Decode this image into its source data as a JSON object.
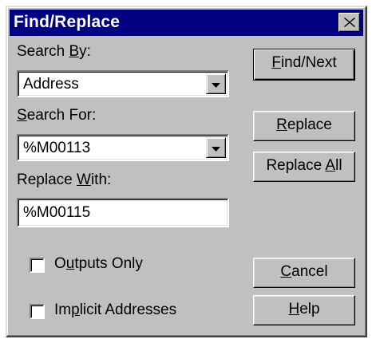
{
  "window": {
    "title": "Find/Replace",
    "close_glyph": "✕"
  },
  "search_by": {
    "label_pre": "Search ",
    "label_mnemonic": "B",
    "label_post": "y:",
    "value": "Address"
  },
  "search_for": {
    "label_pre": "",
    "label_mnemonic": "S",
    "label_post": "earch For:",
    "value": "%M00113"
  },
  "replace_with": {
    "label_pre": "Replace ",
    "label_mnemonic": "W",
    "label_post": "ith:",
    "value": "%M00115"
  },
  "options": {
    "outputs_only": {
      "label_pre": "O",
      "label_mnemonic": "u",
      "label_post": "tputs Only",
      "checked": false
    },
    "implicit_addresses": {
      "label_pre": "Im",
      "label_mnemonic": "p",
      "label_post": "licit Addresses",
      "checked": false
    }
  },
  "buttons": {
    "find_next": {
      "pre": "",
      "mnemonic": "F",
      "post": "ind/Next"
    },
    "replace": {
      "pre": "",
      "mnemonic": "R",
      "post": "eplace"
    },
    "replace_all": {
      "pre": "Replace ",
      "mnemonic": "A",
      "post": "ll"
    },
    "cancel": {
      "pre": "",
      "mnemonic": "C",
      "post": "ancel"
    },
    "help": {
      "pre": "",
      "mnemonic": "H",
      "post": "elp"
    }
  },
  "colors": {
    "titlebar": "#000080",
    "face": "#c0c0c0"
  }
}
